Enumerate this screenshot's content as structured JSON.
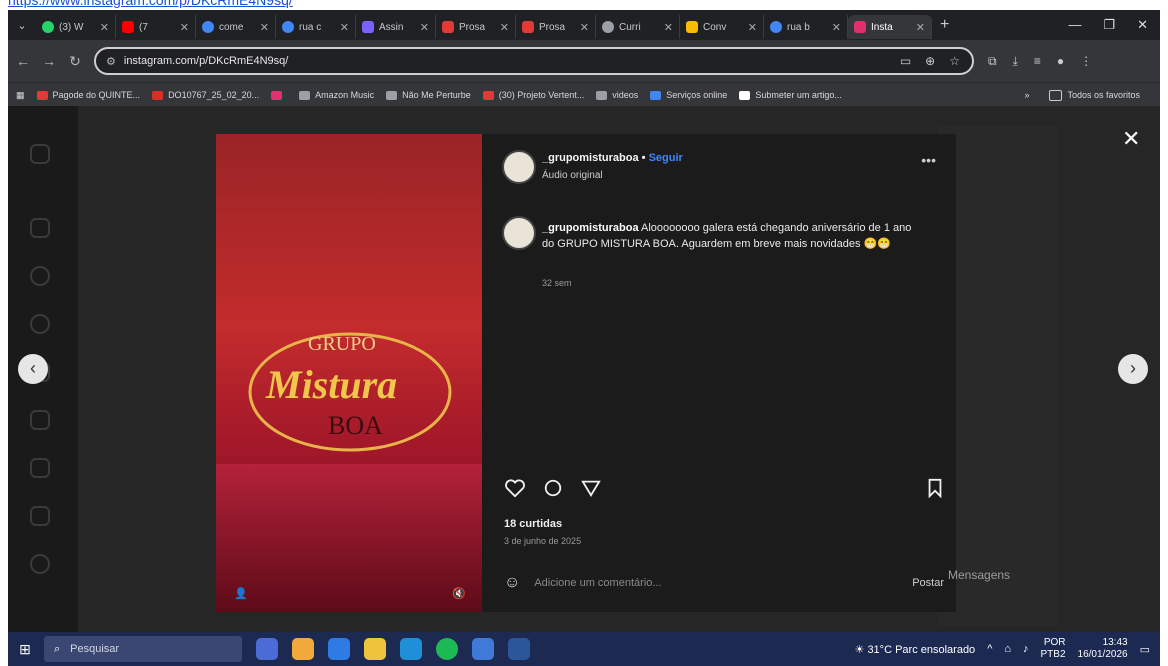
{
  "top_link": "https://www.instagram.com/p/DKcRmE4N9sq/",
  "tabs": [
    {
      "title": "(3) W",
      "color": "#25d366"
    },
    {
      "title": "(7",
      "color": "#ff0000"
    },
    {
      "title": "come",
      "color": "#4285f4"
    },
    {
      "title": "rua c",
      "color": "#4285f4"
    },
    {
      "title": "Assin",
      "color": "#7b61ff"
    },
    {
      "title": "Prosa",
      "color": "#e53935"
    },
    {
      "title": "Prosa",
      "color": "#e53935"
    },
    {
      "title": "Curri",
      "color": "#9aa0a6"
    },
    {
      "title": "Conv",
      "color": "#fbbc04"
    },
    {
      "title": "rua b",
      "color": "#4285f4"
    },
    {
      "title": "Insta",
      "color": "#e1306c"
    }
  ],
  "address": {
    "url": "instagram.com/p/DKcRmE4N9sq/"
  },
  "bookmarks": [
    {
      "label": "Pagode do QUINTE...",
      "color": "#e53935"
    },
    {
      "label": "DO10767_25_02_20...",
      "color": "#d93025"
    },
    {
      "label": "",
      "color": "#e1306c"
    },
    {
      "label": "Amazon Music",
      "color": "#9aa0a6"
    },
    {
      "label": "Não Me Perturbe",
      "color": "#9aa0a6"
    },
    {
      "label": "(30) Projeto Vertent...",
      "color": "#e53935"
    },
    {
      "label": "videos",
      "color": "#9aa0a6"
    },
    {
      "label": "Serviços online",
      "color": "#4285f4"
    },
    {
      "label": "Submeter um artigo...",
      "color": "#ffffff"
    }
  ],
  "bookmarks_overflow": "»",
  "bookmarks_all": "Todos os favoritos",
  "post": {
    "username": "_grupomisturaboa",
    "separator": "•",
    "follow": "Seguir",
    "audio": "Áudio original",
    "caption_user": "_grupomisturaboa",
    "caption_text": "Aloooooooo galera está chegando aniversário de 1 ano do GRUPO MISTURA BOA. Aguardem em breve mais novidades 😁😁",
    "age": "32 sem",
    "likes": "18 curtidas",
    "date": "3 de junho de 2025",
    "comment_placeholder": "Adicione um comentário...",
    "post_button": "Postar"
  },
  "reel_sign": {
    "line1": "GRUPO",
    "line2": "Mistura",
    "line3": "BOA"
  },
  "messages_label": "Mensagens",
  "taskbar": {
    "search_placeholder": "Pesquisar",
    "weather": "31°C  Parc ensolarado",
    "lang_top": "POR",
    "lang_bottom": "PTB2",
    "time": "13:43",
    "date": "16/01/2026"
  }
}
